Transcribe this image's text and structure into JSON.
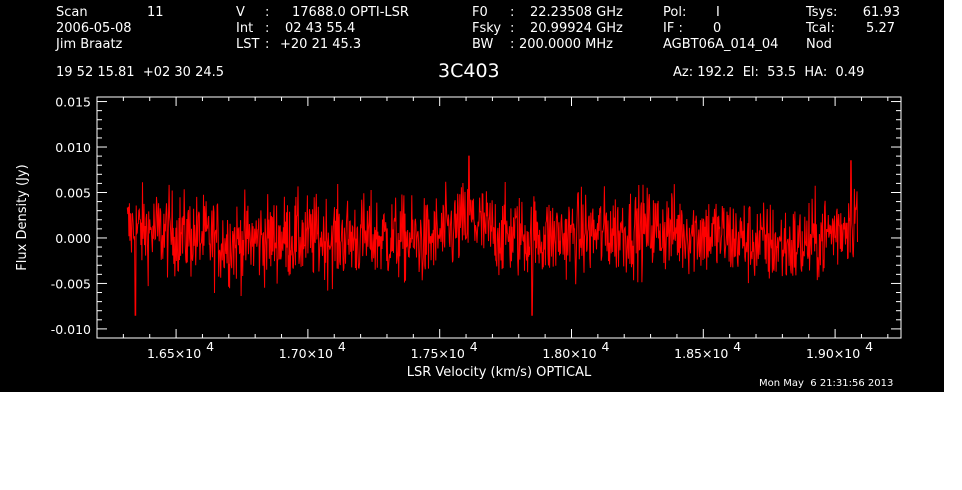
{
  "header": {
    "row1": {
      "scan_label": "Scan",
      "scan_value": "11",
      "v_label": "V",
      "v_value": "17688.0 OPTI-LSR",
      "f0_label": "F0",
      "f0_value": "22.23508 GHz",
      "pol_label": "Pol:",
      "pol_value": "I",
      "tsys_label": "Tsys:",
      "tsys_value": "61.93"
    },
    "row2": {
      "date": "2006-05-08",
      "int_label": "Int",
      "int_value": "02 43 55.4",
      "fsky_label": "Fsky",
      "fsky_value": "20.99924 GHz",
      "if_label": "IF :",
      "if_value": "0",
      "tcal_label": "Tcal:",
      "tcal_value": "5.27"
    },
    "row3": {
      "observer": "Jim Braatz",
      "lst_label": "LST",
      "lst_value": "+20 21 45.3",
      "bw_label": "BW",
      "bw_value": "200.0000 MHz",
      "project": "AGBT06A_014_04",
      "mode": "Nod"
    },
    "coords": "19 52 15.81  +02 30 24.5",
    "source": "3C403",
    "pointing": "Az: 192.2  El:  53.5  HA:  0.49",
    "timestamp": "Mon May  6 21:31:56 2013"
  },
  "chart_data": {
    "type": "line",
    "xlabel": "LSR Velocity (km/s) OPTICAL",
    "ylabel": "Flux Density (Jy)",
    "xlim": [
      16200,
      19250
    ],
    "ylim": [
      -0.011,
      0.0155
    ],
    "x_ticks": [
      {
        "value": 16500,
        "label": "1.65×10",
        "exp": "4"
      },
      {
        "value": 17000,
        "label": "1.70×10",
        "exp": "4"
      },
      {
        "value": 17500,
        "label": "1.75×10",
        "exp": "4"
      },
      {
        "value": 18000,
        "label": "1.80×10",
        "exp": "4"
      },
      {
        "value": 18500,
        "label": "1.85×10",
        "exp": "4"
      },
      {
        "value": 19000,
        "label": "1.90×10",
        "exp": "4"
      }
    ],
    "y_ticks": [
      {
        "value": 0.015,
        "label": "0.015"
      },
      {
        "value": 0.01,
        "label": "0.010"
      },
      {
        "value": 0.005,
        "label": "0.005"
      },
      {
        "value": 0.0,
        "label": "0.000"
      },
      {
        "value": -0.005,
        "label": "-0.005"
      },
      {
        "value": -0.01,
        "label": "-0.010"
      }
    ],
    "series": [
      {
        "color": "#ff0000",
        "x_range": [
          16315,
          19085
        ],
        "n_points": 1400,
        "noise_rms": 0.0023,
        "baseline": [
          [
            16315,
            0.001
          ],
          [
            16500,
            0.0005
          ],
          [
            16700,
            -0.0005
          ],
          [
            16900,
            0.0
          ],
          [
            17100,
            0.0
          ],
          [
            17300,
            0.0
          ],
          [
            17450,
            -0.0005
          ],
          [
            17560,
            0.001
          ],
          [
            17620,
            0.002
          ],
          [
            17700,
            0.0005
          ],
          [
            17900,
            0.0
          ],
          [
            18100,
            0.0005
          ],
          [
            18300,
            0.001
          ],
          [
            18500,
            0.0005
          ],
          [
            18700,
            -0.0005
          ],
          [
            18850,
            -0.001
          ],
          [
            18950,
            0.0
          ],
          [
            19040,
            0.0015
          ],
          [
            19085,
            0.003
          ]
        ],
        "features": [
          {
            "x": 16345,
            "y": -0.0085
          },
          {
            "x": 17610,
            "y": 0.009
          },
          {
            "x": 17850,
            "y": -0.0085
          },
          {
            "x": 19060,
            "y": 0.0085
          }
        ]
      }
    ]
  }
}
